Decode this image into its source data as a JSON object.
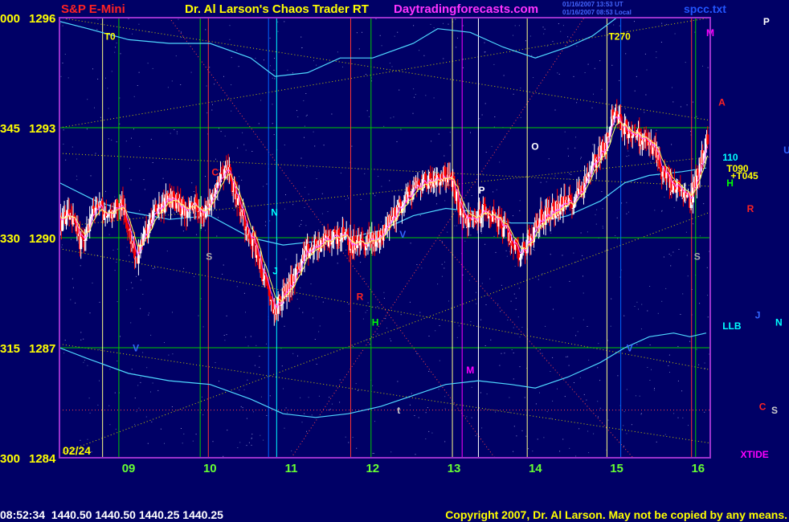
{
  "header": {
    "symbol": "S&P E-Mini",
    "title": "Dr. Al Larson's Chaos Trader RT",
    "site": "Daytradingforecasts.com",
    "stamp1": "01/16/2007 13:53 UT",
    "stamp2": "01/16/2007 08:53 Local",
    "file": "spcc.txt"
  },
  "footer": {
    "quote": "08:52:34  1440.50 1440.50 1440.25 1440.25",
    "copyright": "Copyright 2007, Dr. Al Larson. May not be copied by any means."
  },
  "colors": {
    "background": "#000066",
    "frame": "#9932cc",
    "up_bar": "#ffffff",
    "down_bar": "#ff0000",
    "band": "#4fd7ff",
    "grid": "#00cc00",
    "header_red": "#ff2222",
    "header_yellow": "#ffff00",
    "header_magenta": "#ff33ff",
    "xtide": "#ff00ff"
  },
  "chart_data": {
    "type": "bar",
    "title": "S&P E-Mini",
    "x_ticks": [
      "09",
      "10",
      "11",
      "12",
      "13",
      "14",
      "15",
      "16"
    ],
    "y_ticks": [
      {
        "left": "000",
        "price": "1296"
      },
      {
        "left": "345",
        "price": "1293"
      },
      {
        "left": "330",
        "price": "1290"
      },
      {
        "left": "315",
        "price": "1287"
      },
      {
        "left": "300",
        "price": "1284"
      }
    ],
    "ylim": [
      1284,
      1296
    ],
    "xlim": [
      8.15,
      16.15
    ],
    "date_label": "02/24",
    "grid": true,
    "vertical_lines": [
      {
        "x": 8.68,
        "color": "#ffff88"
      },
      {
        "x": 8.88,
        "color": "#00cc00"
      },
      {
        "x": 9.88,
        "color": "#00cc00"
      },
      {
        "x": 9.98,
        "color": "#ff3333"
      },
      {
        "x": 10.72,
        "color": "#0066ff"
      },
      {
        "x": 10.82,
        "color": "#00ffff"
      },
      {
        "x": 11.73,
        "color": "#ff3333"
      },
      {
        "x": 11.98,
        "color": "#00cc00"
      },
      {
        "x": 12.98,
        "color": "#ffff88"
      },
      {
        "x": 13.1,
        "color": "#ff00ff"
      },
      {
        "x": 13.3,
        "color": "#ffffff"
      },
      {
        "x": 13.9,
        "color": "#ffff88"
      },
      {
        "x": 14.88,
        "color": "#ffff88"
      },
      {
        "x": 15.05,
        "color": "#0066ff"
      },
      {
        "x": 15.92,
        "color": "#ff3333"
      },
      {
        "x": 15.97,
        "color": "#00cc00"
      }
    ],
    "horizontal_lines": [
      {
        "y": 1293.0,
        "color": "#00cc00"
      },
      {
        "y": 1290.0,
        "color": "#00cc00"
      },
      {
        "y": 1287.0,
        "color": "#00cc00"
      }
    ],
    "price_path": [
      [
        8.15,
        1290.4
      ],
      [
        8.3,
        1290.6
      ],
      [
        8.4,
        1289.8
      ],
      [
        8.5,
        1290.3
      ],
      [
        8.6,
        1290.9
      ],
      [
        8.75,
        1290.6
      ],
      [
        8.9,
        1291.0
      ],
      [
        9.0,
        1290.2
      ],
      [
        9.1,
        1289.4
      ],
      [
        9.2,
        1290.1
      ],
      [
        9.35,
        1290.8
      ],
      [
        9.55,
        1291.1
      ],
      [
        9.7,
        1290.7
      ],
      [
        9.82,
        1290.9
      ],
      [
        9.95,
        1290.7
      ],
      [
        10.1,
        1291.6
      ],
      [
        10.2,
        1292.0
      ],
      [
        10.3,
        1291.3
      ],
      [
        10.4,
        1290.6
      ],
      [
        10.55,
        1289.8
      ],
      [
        10.7,
        1288.6
      ],
      [
        10.8,
        1288.0
      ],
      [
        10.92,
        1288.5
      ],
      [
        11.05,
        1289.0
      ],
      [
        11.2,
        1289.6
      ],
      [
        11.4,
        1289.9
      ],
      [
        11.6,
        1290.1
      ],
      [
        11.75,
        1289.8
      ],
      [
        11.9,
        1289.9
      ],
      [
        12.05,
        1289.9
      ],
      [
        12.25,
        1290.6
      ],
      [
        12.45,
        1291.2
      ],
      [
        12.6,
        1291.5
      ],
      [
        12.75,
        1291.6
      ],
      [
        12.9,
        1291.7
      ],
      [
        13.0,
        1291.4
      ],
      [
        13.1,
        1290.6
      ],
      [
        13.2,
        1290.4
      ],
      [
        13.35,
        1290.7
      ],
      [
        13.5,
        1290.6
      ],
      [
        13.65,
        1290.1
      ],
      [
        13.8,
        1289.6
      ],
      [
        13.9,
        1289.8
      ],
      [
        14.05,
        1290.5
      ],
      [
        14.25,
        1290.8
      ],
      [
        14.45,
        1291.0
      ],
      [
        14.6,
        1291.5
      ],
      [
        14.75,
        1292.2
      ],
      [
        14.88,
        1292.6
      ],
      [
        14.95,
        1293.4
      ],
      [
        15.1,
        1293.0
      ],
      [
        15.3,
        1292.7
      ],
      [
        15.45,
        1292.5
      ],
      [
        15.6,
        1291.6
      ],
      [
        15.75,
        1291.3
      ],
      [
        15.9,
        1291.0
      ],
      [
        16.0,
        1291.8
      ],
      [
        16.1,
        1292.6
      ]
    ],
    "upper_band": [
      [
        8.15,
        1295.9
      ],
      [
        8.5,
        1295.7
      ],
      [
        9.0,
        1295.4
      ],
      [
        9.5,
        1295.3
      ],
      [
        10.0,
        1295.3
      ],
      [
        10.5,
        1294.9
      ],
      [
        10.8,
        1294.4
      ],
      [
        11.2,
        1294.5
      ],
      [
        11.6,
        1294.9
      ],
      [
        12.0,
        1294.9
      ],
      [
        12.5,
        1295.3
      ],
      [
        12.8,
        1295.7
      ],
      [
        13.2,
        1295.6
      ],
      [
        13.6,
        1295.2
      ],
      [
        14.0,
        1294.9
      ],
      [
        14.4,
        1295.2
      ],
      [
        14.7,
        1295.5
      ],
      [
        15.0,
        1296.0
      ],
      [
        15.3,
        1296.0
      ],
      [
        15.6,
        1296.0
      ],
      [
        15.9,
        1296.0
      ],
      [
        16.1,
        1296.0
      ]
    ],
    "middle_band": [
      [
        8.15,
        1291.5
      ],
      [
        8.6,
        1291.0
      ],
      [
        9.0,
        1290.7
      ],
      [
        9.5,
        1290.5
      ],
      [
        10.0,
        1290.6
      ],
      [
        10.5,
        1290.0
      ],
      [
        10.9,
        1289.8
      ],
      [
        11.3,
        1289.9
      ],
      [
        11.7,
        1290.0
      ],
      [
        12.1,
        1290.2
      ],
      [
        12.5,
        1290.6
      ],
      [
        12.9,
        1290.8
      ],
      [
        13.3,
        1290.7
      ],
      [
        13.7,
        1290.4
      ],
      [
        14.0,
        1290.4
      ],
      [
        14.4,
        1290.6
      ],
      [
        14.8,
        1291.0
      ],
      [
        15.1,
        1291.5
      ],
      [
        15.4,
        1291.7
      ],
      [
        15.8,
        1291.8
      ],
      [
        16.1,
        1291.9
      ]
    ],
    "lower_band": [
      [
        8.15,
        1287.0
      ],
      [
        8.5,
        1286.7
      ],
      [
        9.0,
        1286.3
      ],
      [
        9.5,
        1286.1
      ],
      [
        10.0,
        1286.0
      ],
      [
        10.5,
        1285.6
      ],
      [
        10.9,
        1285.2
      ],
      [
        11.3,
        1285.1
      ],
      [
        11.7,
        1285.2
      ],
      [
        12.1,
        1285.4
      ],
      [
        12.5,
        1285.7
      ],
      [
        12.9,
        1286.0
      ],
      [
        13.3,
        1286.1
      ],
      [
        13.7,
        1286.0
      ],
      [
        14.0,
        1285.9
      ],
      [
        14.4,
        1286.2
      ],
      [
        14.8,
        1286.6
      ],
      [
        15.1,
        1287.0
      ],
      [
        15.4,
        1287.3
      ],
      [
        15.7,
        1287.4
      ],
      [
        15.9,
        1287.3
      ],
      [
        16.1,
        1287.4
      ]
    ],
    "inner_annotations": [
      {
        "text": "T0",
        "x": 8.7,
        "y": 1295.4,
        "color": "#ffff00"
      },
      {
        "text": "T270",
        "x": 14.9,
        "y": 1295.4,
        "color": "#ffff00"
      },
      {
        "text": "M",
        "x": 16.1,
        "y": 1295.5,
        "color": "#ff00ff"
      },
      {
        "text": "A",
        "x": 16.25,
        "y": 1293.6,
        "color": "#ff2222"
      },
      {
        "text": "O",
        "x": 13.95,
        "y": 1292.4,
        "color": "#ffffff"
      },
      {
        "text": "C",
        "x": 10.02,
        "y": 1291.7,
        "color": "#ff2222"
      },
      {
        "text": "P",
        "x": 13.3,
        "y": 1291.2,
        "color": "#ffffff"
      },
      {
        "text": "N",
        "x": 10.75,
        "y": 1290.6,
        "color": "#00ffff"
      },
      {
        "text": "S",
        "x": 9.95,
        "y": 1289.4,
        "color": "#aaaaaa"
      },
      {
        "text": "S",
        "x": 15.95,
        "y": 1289.4,
        "color": "#aaaaaa"
      },
      {
        "text": "V",
        "x": 12.33,
        "y": 1290.0,
        "color": "#3366ff"
      },
      {
        "text": "J",
        "x": 10.77,
        "y": 1289.0,
        "color": "#00ffff"
      },
      {
        "text": "R",
        "x": 11.8,
        "y": 1288.3,
        "color": "#ff2222"
      },
      {
        "text": "H",
        "x": 11.99,
        "y": 1287.6,
        "color": "#00ff00"
      },
      {
        "text": "V",
        "x": 9.05,
        "y": 1286.9,
        "color": "#3366ff"
      },
      {
        "text": "V",
        "x": 15.12,
        "y": 1286.9,
        "color": "#3366ff"
      },
      {
        "text": "M",
        "x": 13.15,
        "y": 1286.3,
        "color": "#ff00ff"
      },
      {
        "text": "t",
        "x": 12.3,
        "y": 1285.2,
        "color": "#cccccc"
      }
    ],
    "right_labels": [
      {
        "text": "110",
        "x": 16.3,
        "y": 1292.1,
        "color": "#00ffff"
      },
      {
        "text": "T090",
        "x": 16.35,
        "y": 1291.8,
        "color": "#ffff00"
      },
      {
        "text": "+T045",
        "x": 16.4,
        "y": 1291.6,
        "color": "#ffff00"
      },
      {
        "text": "H",
        "x": 16.35,
        "y": 1291.4,
        "color": "#00ff00"
      },
      {
        "text": "LLB",
        "x": 16.3,
        "y": 1287.5,
        "color": "#00ffff"
      },
      {
        "text": "P",
        "x": 16.8,
        "y": 1295.8,
        "color": "#ffffff"
      },
      {
        "text": "U",
        "x": 17.05,
        "y": 1292.3,
        "color": "#3366ff"
      },
      {
        "text": "R",
        "x": 16.6,
        "y": 1290.7,
        "color": "#ff2222"
      },
      {
        "text": "J",
        "x": 16.7,
        "y": 1287.8,
        "color": "#3366ff"
      },
      {
        "text": "N",
        "x": 16.95,
        "y": 1287.6,
        "color": "#00ffff"
      },
      {
        "text": "C",
        "x": 16.75,
        "y": 1285.3,
        "color": "#ff2222"
      },
      {
        "text": "S",
        "x": 16.9,
        "y": 1285.2,
        "color": "#cccccc"
      },
      {
        "text": "XTIDE",
        "x": 16.52,
        "y": 1284.0,
        "color": "#ff00ff"
      }
    ],
    "lane_lines": [
      {
        "from": [
          8.15,
          1296.0
        ],
        "to": [
          16.15,
          1293.2
        ],
        "color": "#cccc00"
      },
      {
        "from": [
          8.15,
          1293.0
        ],
        "to": [
          16.15,
          1296.0
        ],
        "color": "#cccc00"
      },
      {
        "from": [
          8.15,
          1292.3
        ],
        "to": [
          16.15,
          1291.4
        ],
        "color": "#cccc00"
      },
      {
        "from": [
          8.15,
          1290.3
        ],
        "to": [
          16.15,
          1292.2
        ],
        "color": "#cccc00"
      },
      {
        "from": [
          8.15,
          1289.7
        ],
        "to": [
          16.15,
          1286.4
        ],
        "color": "#cccc00"
      },
      {
        "from": [
          8.15,
          1284.1
        ],
        "to": [
          16.15,
          1290.7
        ],
        "color": "#cccc00"
      },
      {
        "from": [
          8.15,
          1287.1
        ],
        "to": [
          16.15,
          1284.4
        ],
        "color": "#cccc00"
      },
      {
        "from": [
          9.5,
          1296.0
        ],
        "to": [
          13.5,
          1284.0
        ],
        "color": "#ff4444"
      },
      {
        "from": [
          11.0,
          1284.0
        ],
        "to": [
          14.6,
          1296.0
        ],
        "color": "#ff4444"
      },
      {
        "from": [
          12.8,
          1290.0
        ],
        "to": [
          15.2,
          1284.0
        ],
        "color": "#ff4444"
      },
      {
        "from": [
          8.15,
          1285.3
        ],
        "to": [
          16.15,
          1285.3
        ],
        "color": "#ff4444"
      }
    ]
  }
}
